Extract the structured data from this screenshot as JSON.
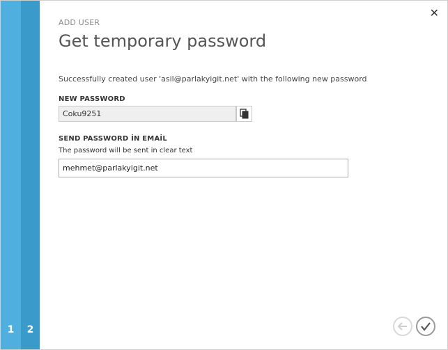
{
  "steps": [
    {
      "label": "1"
    },
    {
      "label": "2"
    }
  ],
  "header": {
    "kicker": "ADD USER",
    "title": "Get temporary password"
  },
  "message": "Successfully created user 'asil@parlakyigit.net' with the following new password",
  "new_password": {
    "label": "NEW PASSWORD",
    "value": "Coku9251"
  },
  "send_email": {
    "label": "SEND PASSWORD İN EMAİL",
    "hint": "The password will be sent in clear text",
    "value": "mehmet@parlakyigit.net"
  },
  "icons": {
    "close": "close-icon",
    "copy": "copy-icon",
    "back": "back-arrow-icon",
    "done": "checkmark-icon"
  },
  "colors": {
    "step1": "#4fb0e0",
    "step2": "#3a9ac9"
  }
}
